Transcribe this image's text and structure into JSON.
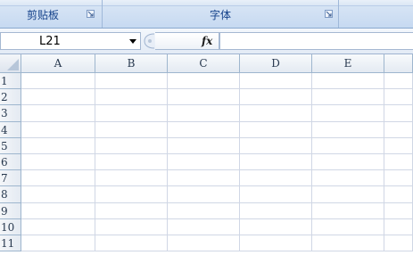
{
  "ribbon": {
    "groups": [
      {
        "label": "剪贴板",
        "launcher_icon": "dialog-launcher-icon"
      },
      {
        "label": "字体",
        "launcher_icon": "dialog-launcher-icon"
      },
      {
        "label": ""
      }
    ]
  },
  "formula_bar": {
    "name_box": "L21",
    "name_box_icon": "dropdown-arrow-icon",
    "function_icon_label": "fx",
    "formula_value": ""
  },
  "sheet": {
    "corner_icon": "select-all-icon",
    "columns": [
      "A",
      "B",
      "C",
      "D",
      "E",
      ""
    ],
    "rows": [
      "1",
      "2",
      "3",
      "4",
      "5",
      "6",
      "7",
      "8",
      "9",
      "10",
      "11"
    ]
  },
  "colors": {
    "ribbon_text": "#15428b",
    "header_border": "#9eb6ce",
    "gridline": "#d0d7e5"
  }
}
